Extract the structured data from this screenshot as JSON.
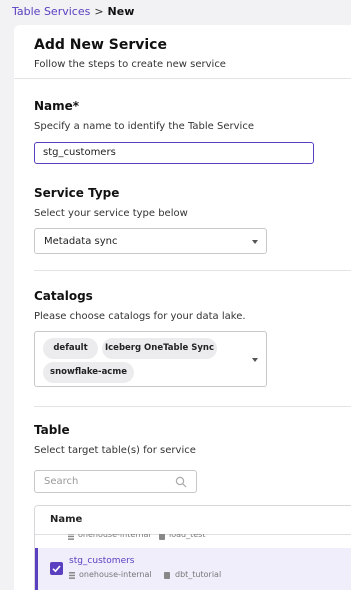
{
  "breadcrumb": {
    "parent": "Table Services",
    "separator": ">",
    "current": "New"
  },
  "header": {
    "title": "Add New Service",
    "subtitle": "Follow the steps to create new service"
  },
  "name_section": {
    "title": "Name*",
    "description": "Specify a name to identify the Table Service",
    "value": "stg_customers"
  },
  "service_type_section": {
    "title": "Service Type",
    "description": "Select your service type below",
    "selected": "Metadata sync"
  },
  "catalogs_section": {
    "title": "Catalogs",
    "description": "Please choose catalogs for your data lake.",
    "chips": [
      "default",
      "Iceberg OneTable Sync",
      "snowflake-acme"
    ]
  },
  "table_section": {
    "title": "Table",
    "description": "Select target table(s) for service",
    "search_placeholder": "Search",
    "column_header": "Name",
    "partial_row": {
      "project": "onehouse-internal",
      "database": "load_test"
    },
    "selected_row": {
      "name": "stg_customers",
      "project": "onehouse-internal",
      "database": "dbt_tutorial",
      "checked": true
    }
  },
  "colors": {
    "accent": "#5a3fc0",
    "selected_row_bg": "#f0eefb",
    "chip_bg": "#ececee"
  }
}
